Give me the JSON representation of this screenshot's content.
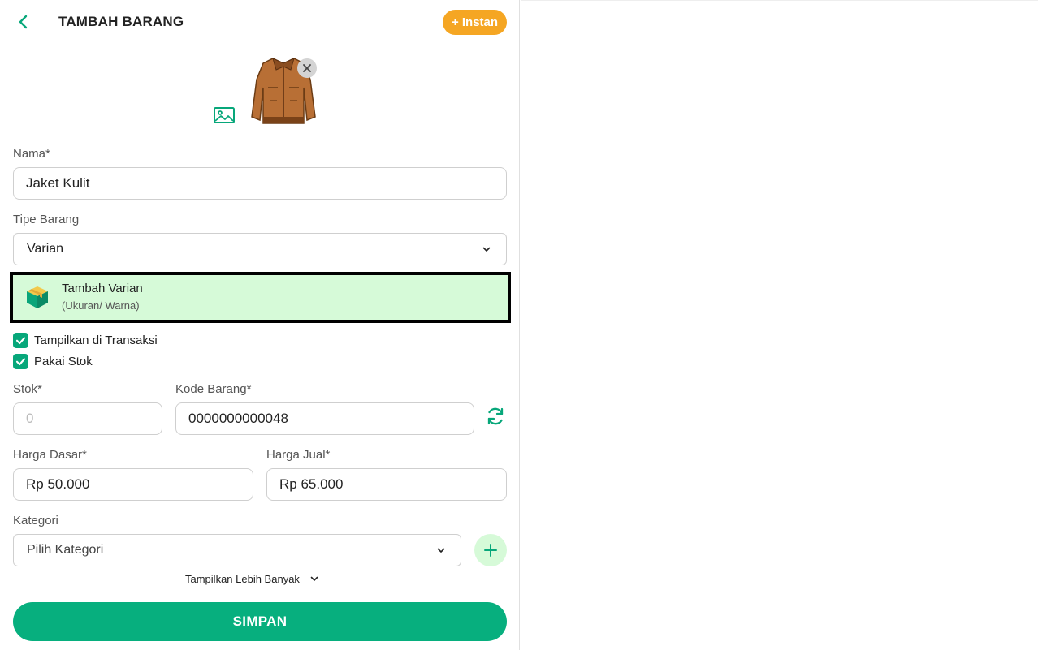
{
  "header": {
    "title": "TAMBAH BARANG",
    "instan_label": "+ Instan",
    "back_icon": "chevron-left-icon"
  },
  "image": {
    "placeholder_icon": "image-icon",
    "product_image": "brown-leather-jacket",
    "remove_icon": "close-icon"
  },
  "form": {
    "nama": {
      "label": "Nama*",
      "value": "Jaket Kulit"
    },
    "tipe_barang": {
      "label": "Tipe Barang",
      "selected": "Varian"
    },
    "variant": {
      "title": "Tambah Varian",
      "subtitle": "(Ukuran/ Warna)",
      "icon": "box-icon"
    },
    "checkboxes": [
      {
        "label": "Tampilkan di Transaksi",
        "checked": true
      },
      {
        "label": "Pakai Stok",
        "checked": true
      }
    ],
    "stok": {
      "label": "Stok*",
      "placeholder": "0",
      "value": ""
    },
    "kode_barang": {
      "label": "Kode Barang*",
      "value": "0000000000048"
    },
    "harga_dasar": {
      "label": "Harga Dasar*",
      "value": "Rp 50.000"
    },
    "harga_jual": {
      "label": "Harga Jual*",
      "value": "Rp 65.000"
    },
    "kategori": {
      "label": "Kategori",
      "selected": "Pilih Kategori"
    },
    "show_more": "Tampilkan Lebih Banyak"
  },
  "footer": {
    "save_label": "SIMPAN"
  },
  "colors": {
    "accent_green": "#07af7e",
    "highlight_green": "#d6fad8",
    "orange": "#f5a623"
  }
}
